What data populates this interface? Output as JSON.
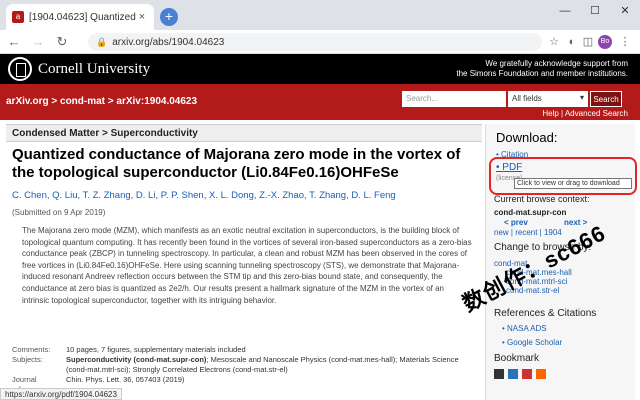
{
  "browser": {
    "tab_title": "[1904.04623] Quantized conductance",
    "tab_favicon": "arXiv",
    "url": "arxiv.org/abs/1904.04623",
    "avatar_initials": "Bo"
  },
  "cornell": {
    "name": "Cornell University",
    "ack_line1": "We gratefully acknowledge support from",
    "ack_line2": "the Simons Foundation and member institutions."
  },
  "nav": {
    "breadcrumb": "arXiv.org > cond-mat > arXiv:1904.04623",
    "search_placeholder": "Search...",
    "field_select": "All fields",
    "search_button": "Search",
    "help_links": "Help | Advanced Search"
  },
  "paper": {
    "subject_header": "Condensed Matter > Superconductivity",
    "title": "Quantized conductance of Majorana zero mode in the vortex of the topological superconductor (Li0.84Fe0.16)OHFeSe",
    "authors": "C. Chen, Q. Liu, T. Z. Zhang, D. Li, P. P. Shen, X. L. Dong, Z.-X. Zhao, T. Zhang, D. L. Feng",
    "submitted": "(Submitted on 9 Apr 2019)",
    "abstract": "The Majorana zero mode (MZM), which manifests as an exotic neutral excitation in superconductors, is the building block of topological quantum computing. It has recently been found in the vortices of several iron-based superconductors as a zero-bias conductance peak (ZBCP) in tunneling spectroscopy. In particular, a clean and robust MZM has been observed in the cores of free vortices in (Li0.84Fe0.16)OHFeSe. Here using scanning tunneling spectroscopy (STS), we demonstrate that Majorana-induced resonant Andreev reflection occurs between the STM tip and this zero-bias bound state, and consequently, the conductance at zero bias is quantized as 2e2/h. Our results present a hallmark signature of the MZM in the vortex of an intrinsic topological superconductor, together with its intriguing behavior.",
    "comments_label": "Comments:",
    "comments": "10 pages, 7 figures, supplementary materials included",
    "subjects_label": "Subjects:",
    "subjects_bold": "Superconductivity (cond-mat.supr-con)",
    "subjects_rest": "; Mesoscale and Nanoscale Physics (cond-mat.mes-hall); Materials Science (cond-mat.mtrl-sci); Strongly Correlated Electrons (cond-mat.str-el)",
    "journal_label": "Journal reference:",
    "journal": "Chin. Phys. Lett. 36, 057403 (2019)",
    "doi_partial": "1088/0256-307X/36/5/057403"
  },
  "sidebar": {
    "download_heading": "Download:",
    "citation": "Citation",
    "pdf": "PDF",
    "license": "(license)",
    "tooltip": "Click to view or drag to download",
    "browse_heading": "Current browse context:",
    "browse_context": "cond-mat.supr-con",
    "prev": "< prev",
    "next": "next >",
    "new_recent": "new | recent | 1904",
    "change_heading": "Change to browse by:",
    "browse_by": [
      "cond-mat",
      "cond-mat.mes-hall",
      "cond-mat.mtrl-sci",
      "cond-mat.str-el"
    ],
    "refs_heading": "References & Citations",
    "nasa_ads": "NASA ADS",
    "google_scholar": "Google Scholar",
    "bookmark_heading": "Bookmark"
  },
  "watermark": "数创作：sc666",
  "statusbar": "https://arxiv.org/pdf/1904.04623",
  "colors": {
    "arxiv_red": "#b31b1b",
    "highlight": "#e82323",
    "link": "#1a5fb4"
  }
}
